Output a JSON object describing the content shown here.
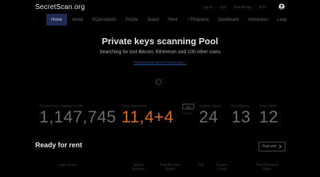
{
  "app": {
    "brand": "SecretScan.org"
  },
  "top_links": [
    "Log In",
    "Join",
    "Fail Mining",
    "ETH"
  ],
  "nav": {
    "items": [
      {
        "label": "Home",
        "active": true
      },
      {
        "label": "About",
        "active": false
      },
      {
        "label": "ECalculators",
        "active": false
      },
      {
        "label": "Puzzle",
        "active": false
      },
      {
        "label": "Guest",
        "active": false
      },
      {
        "label": "Rent",
        "active": false
      },
      {
        "label": "∵ Programs",
        "active": false
      },
      {
        "label": "Dashboard",
        "active": false
      },
      {
        "label": "Admission",
        "active": false
      },
      {
        "label": "Lang",
        "active": false
      }
    ]
  },
  "hero": {
    "title": "Private keys scanning Pool",
    "subtitle": "Searching for lost Bitcoin, Ethereum and 100 other coins",
    "link": "Find out more about Private keys ›"
  },
  "stats": [
    {
      "label": "Private Keys checked in 24h",
      "value": "1,147,745",
      "color": "#6a6a6a"
    },
    {
      "label": "Keys checked in",
      "value": "11,4+4",
      "color": "#d96a1b"
    },
    {
      "label": "Graphic Cards",
      "value": "24",
      "color": "#6a6a6a"
    },
    {
      "label": "Pool Miners",
      "value": "13",
      "color": "#6a6a6a"
    },
    {
      "label": "Years Work",
      "value": "12",
      "color": "#6a6a6a"
    }
  ],
  "bits": {
    "badge": "bits",
    "sub": "Ranges"
  },
  "rent": {
    "title": "Ready for rent",
    "button": "Post rent",
    "columns": [
      "Login Status",
      "Speed Balance",
      "Pool Bit Limit Speed",
      "Pay",
      "Graphic Cards",
      "Total Checked Value"
    ]
  }
}
